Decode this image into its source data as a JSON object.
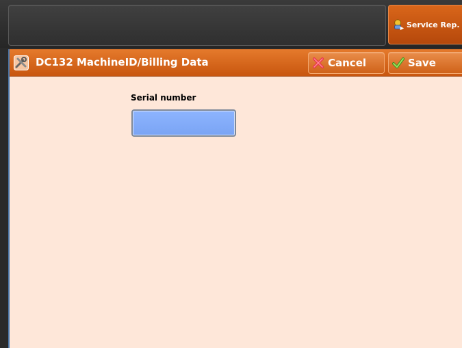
{
  "header": {
    "service_button_label": "Service Rep."
  },
  "window": {
    "title": "DC132 MachineID/Billing Data",
    "cancel_label": "Cancel",
    "save_label": "Save"
  },
  "form": {
    "serial_number_label": "Serial number",
    "serial_number_value": ""
  },
  "colors": {
    "accent_orange": "#d9661a",
    "window_background": "#fee7d9",
    "input_fill": "#8db4ff",
    "top_bar": "#2f2f2f"
  },
  "icons": {
    "service": "service-rep-icon",
    "title": "tools-icon",
    "cancel": "cancel-x-icon",
    "save": "checkmark-icon"
  }
}
